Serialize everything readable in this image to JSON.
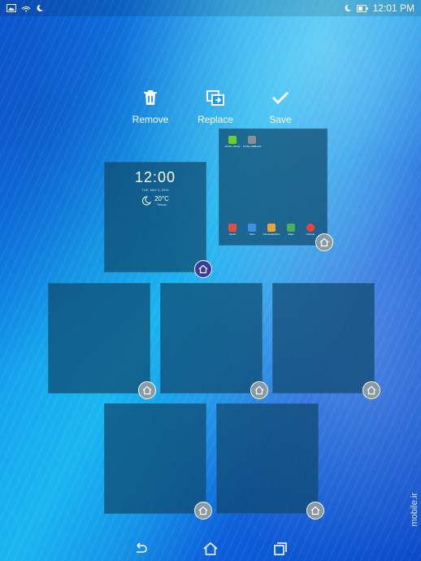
{
  "status": {
    "time": "12:01 PM"
  },
  "actions": {
    "remove": "Remove",
    "replace": "Replace",
    "save": "Save"
  },
  "widget": {
    "time": "12:00",
    "date": "TUE, MAY 5, 2015",
    "temp": "20°C",
    "location": "Tehran"
  },
  "apps_top": [
    {
      "label": "AsTiFu GOver",
      "color": "#6ccf2a"
    },
    {
      "label": "AsTiFu GBBoard",
      "color": "#8a8f96"
    }
  ],
  "apps_dock": [
    {
      "label": "ZenUI",
      "color": "#e84c3d"
    },
    {
      "label": "Tools",
      "color": "#3f8ee6"
    },
    {
      "label": "Personalization",
      "color": "#f1a33a"
    },
    {
      "label": "Maps",
      "color": "#4caf50"
    },
    {
      "label": "Chrome",
      "color": "#f44336"
    }
  ],
  "watermark": "mobile.ir"
}
